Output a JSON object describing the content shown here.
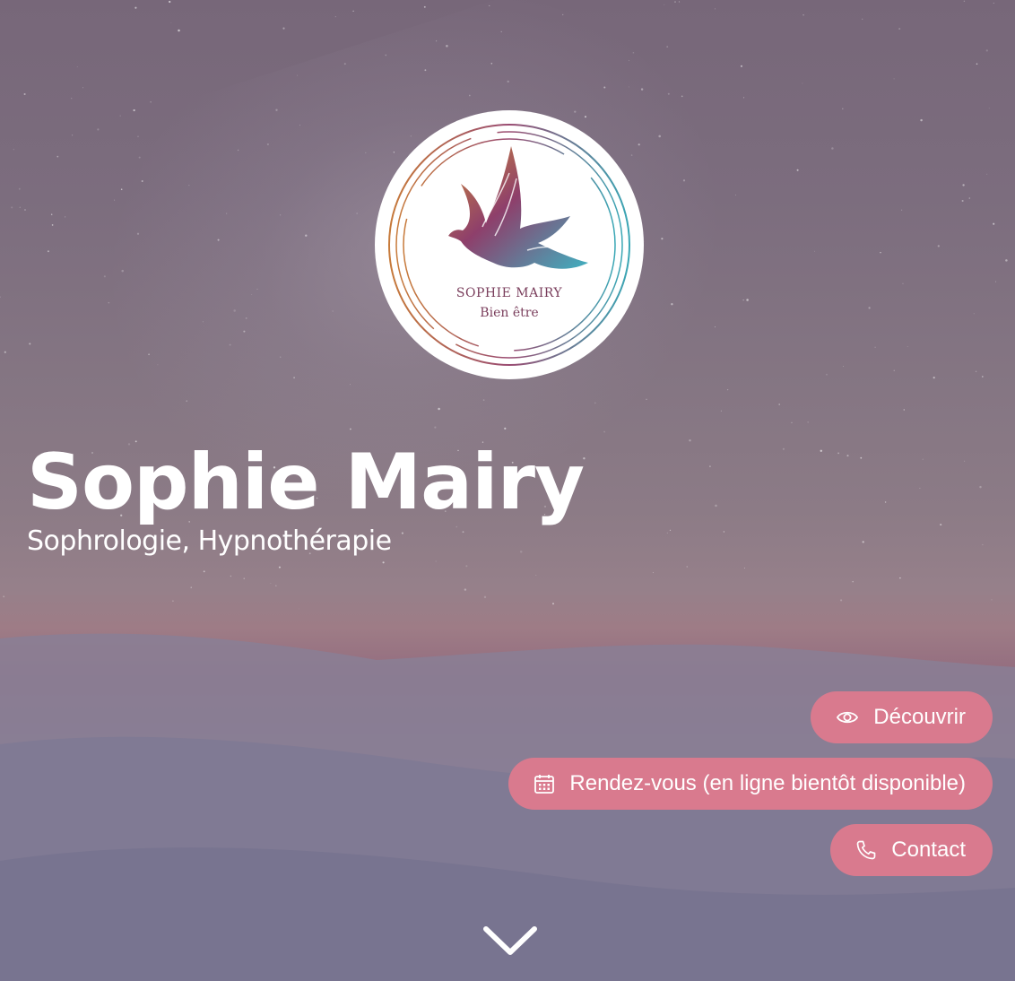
{
  "logo": {
    "name_line": "SOPHIE MAIRY",
    "tagline_line": "Bien être",
    "icon": "dove-icon"
  },
  "hero": {
    "title": "Sophie Mairy",
    "subtitle": "Sophrologie, Hypnothérapie"
  },
  "actions": {
    "discover": {
      "label": "Découvrir",
      "icon": "eye-icon"
    },
    "appointment": {
      "label": "Rendez-vous (en ligne bientôt disponible)",
      "icon": "calendar-icon"
    },
    "contact": {
      "label": "Contact",
      "icon": "phone-icon"
    }
  },
  "scroll": {
    "icon": "chevron-down-icon"
  },
  "colors": {
    "button_bg": "#d97a8e",
    "text": "#ffffff",
    "logo_bg": "#ffffff",
    "logo_text": "#7a3e5c"
  }
}
